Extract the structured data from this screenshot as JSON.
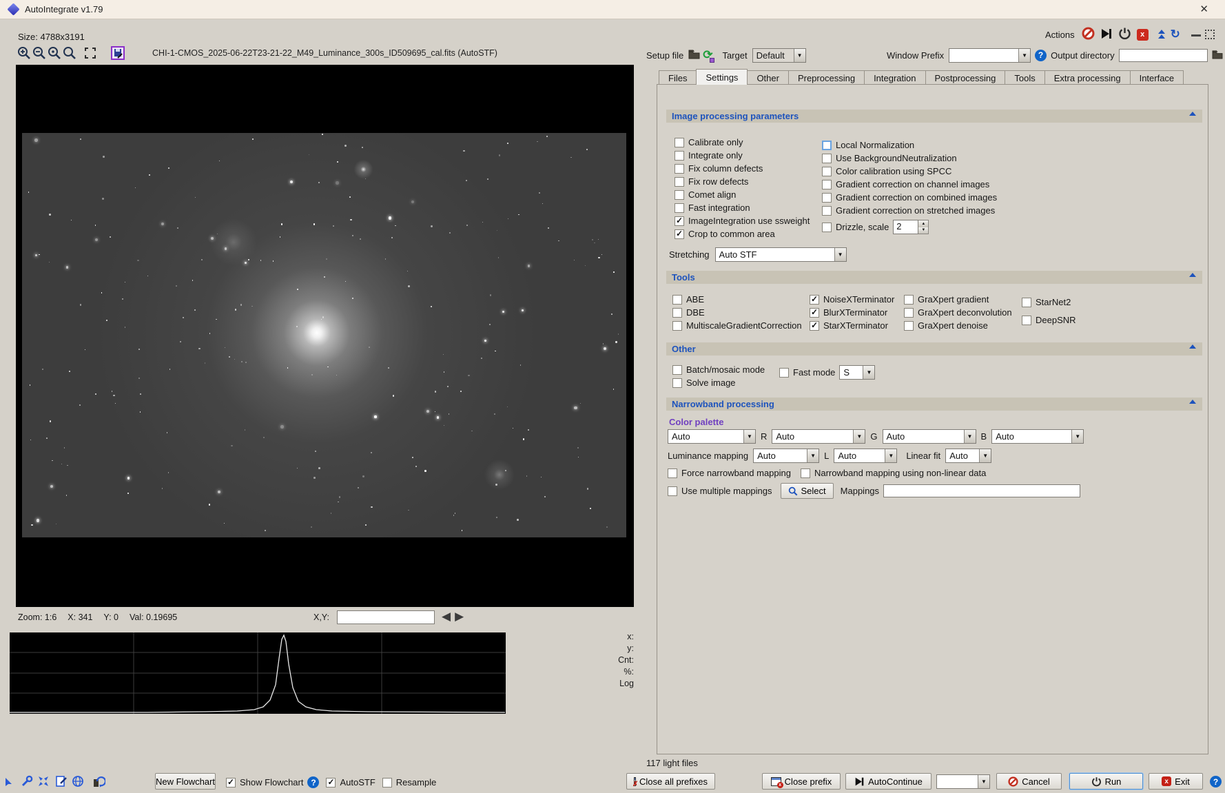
{
  "window": {
    "title": "AutoIntegrate v1.79",
    "close_glyph": "✕"
  },
  "topbar": {
    "size_label": "Size: 4788x3191",
    "actions_label": "Actions",
    "setup_file_label": "Setup file",
    "target_label": "Target",
    "target_value": "Default",
    "window_prefix_label": "Window Prefix",
    "window_prefix_value": "",
    "output_dir_label": "Output directory",
    "output_dir_value": ""
  },
  "viewer": {
    "filename": "CHI-1-CMOS_2025-06-22T23-21-22_M49_Luminance_300s_ID509695_cal.fits (AutoSTF)",
    "status_parts": [
      "Zoom: 1:6",
      "X: 341",
      "Y: 0",
      "Val: 0.19695"
    ],
    "xy_label": "X,Y:",
    "xy_value": "",
    "hist_labels": [
      "x:",
      "y:",
      "Cnt:",
      "%:",
      "Log"
    ]
  },
  "tabs": [
    "Files",
    "Settings",
    "Other",
    "Preprocessing",
    "Integration",
    "Postprocessing",
    "Tools",
    "Extra processing",
    "Interface"
  ],
  "active_tab_index": 1,
  "sections": {
    "image_processing": {
      "title": "Image processing parameters",
      "left_checks": [
        {
          "label": "Calibrate only",
          "checked": false
        },
        {
          "label": "Integrate only",
          "checked": false
        },
        {
          "label": "Fix column defects",
          "checked": false
        },
        {
          "label": "Fix row defects",
          "checked": false
        },
        {
          "label": "Comet align",
          "checked": false
        },
        {
          "label": "Fast integration",
          "checked": false
        },
        {
          "label": "ImageIntegration use ssweight",
          "checked": true
        },
        {
          "label": "Crop to common area",
          "checked": true
        }
      ],
      "right_checks": [
        {
          "label": "Local Normalization",
          "checked": false,
          "focus": true
        },
        {
          "label": "Use BackgroundNeutralization",
          "checked": false
        },
        {
          "label": "Color calibration using SPCC",
          "checked": false
        },
        {
          "label": "Gradient correction on channel images",
          "checked": false
        },
        {
          "label": "Gradient correction on combined images",
          "checked": false
        },
        {
          "label": "Gradient correction on stretched images",
          "checked": false
        }
      ],
      "drizzle": {
        "label": "Drizzle, scale",
        "checked": false,
        "value": "2"
      },
      "stretching_label": "Stretching",
      "stretching_value": "Auto STF"
    },
    "tools": {
      "title": "Tools",
      "col1": [
        {
          "label": "ABE",
          "checked": false
        },
        {
          "label": "DBE",
          "checked": false
        },
        {
          "label": "MultiscaleGradientCorrection",
          "checked": false
        }
      ],
      "col2": [
        {
          "label": "NoiseXTerminator",
          "checked": true
        },
        {
          "label": "BlurXTerminator",
          "checked": true
        },
        {
          "label": "StarXTerminator",
          "checked": true
        }
      ],
      "col3": [
        {
          "label": "GraXpert gradient",
          "checked": false
        },
        {
          "label": "GraXpert deconvolution",
          "checked": false
        },
        {
          "label": "GraXpert denoise",
          "checked": false
        }
      ],
      "col4": [
        {
          "label": "StarNet2",
          "checked": false
        },
        {
          "label": "DeepSNR",
          "checked": false
        }
      ]
    },
    "other": {
      "title": "Other",
      "checks": [
        {
          "label": "Batch/mosaic mode",
          "checked": false
        },
        {
          "label": "Solve image",
          "checked": false
        }
      ],
      "fast_mode": {
        "label": "Fast mode",
        "checked": false,
        "value": "S"
      }
    },
    "narrowband": {
      "title": "Narrowband processing",
      "color_palette_label": "Color palette",
      "palette_value": "Auto",
      "r_label": "R",
      "r_value": "Auto",
      "g_label": "G",
      "g_value": "Auto",
      "b_label": "B",
      "b_value": "Auto",
      "luminance_mapping_label": "Luminance mapping",
      "luminance_value": "Auto",
      "l_label": "L",
      "l_value": "Auto",
      "linear_fit_label": "Linear fit",
      "linear_fit_value": "Auto",
      "force_mapping": {
        "label": "Force narrowband mapping",
        "checked": false
      },
      "nonlinear_mapping": {
        "label": "Narrowband mapping using non-linear data",
        "checked": false
      },
      "multiple_mappings": {
        "label": "Use multiple mappings",
        "checked": false
      },
      "select_label": "Select",
      "mappings_label": "Mappings",
      "mappings_value": ""
    }
  },
  "bottom": {
    "light_files": "117 light files",
    "new_flowchart": "New Flowchart",
    "show_flowchart": {
      "label": "Show Flowchart",
      "checked": true
    },
    "autostf": {
      "label": "AutoSTF",
      "checked": true
    },
    "resample": {
      "label": "Resample",
      "checked": false
    },
    "close_all_prefixes": "Close all prefixes",
    "close_prefix": "Close prefix",
    "autocontinue": "AutoContinue",
    "cancel": "Cancel",
    "run": "Run",
    "exit": "Exit"
  },
  "colors": {
    "header_blue": "#1d53bd",
    "palette_purple": "#7040c0",
    "titlebar_bg": "#f5eee5",
    "section_bar_bg": "#c8c3b5",
    "danger_red": "#cc2a1e",
    "help_blue": "#1064c8"
  }
}
